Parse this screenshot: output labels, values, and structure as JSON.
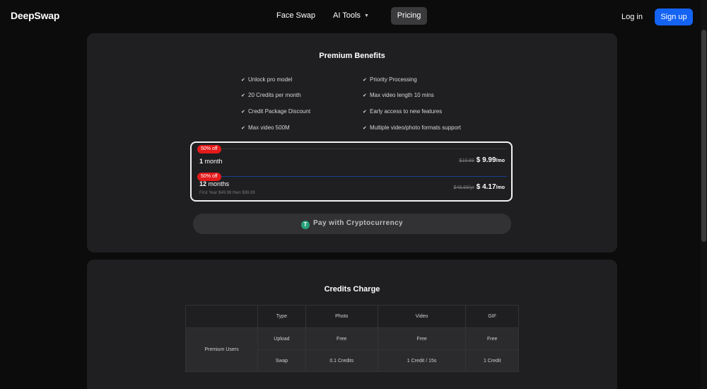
{
  "nav": {
    "logo": "DeepSwap",
    "links": [
      "Face Swap",
      "AI Tools",
      "Pricing"
    ],
    "login": "Log in",
    "signup": "Sign up"
  },
  "premium": {
    "title": "Premium Benefits",
    "benefits_left": [
      "Unlock pro model",
      "20 Credits per month",
      "Credit Package Discount",
      "Max video 500M"
    ],
    "benefits_right": [
      "Priority Processing",
      "Max video length 10 mins",
      "Early access to new features",
      "Multiple video/photo formats support"
    ],
    "plans": [
      {
        "badge": "50% off",
        "count": "1",
        "unit": " month",
        "sub": "",
        "old_price": "$19.99",
        "price": "$ 9.99",
        "per": "/mo"
      },
      {
        "badge": "50% off",
        "count": "12",
        "unit": " months",
        "sub": "First Year $49.99 then $99.99",
        "old_price": "$49.99/yr",
        "price": "$ 4.17",
        "per": "/mo"
      }
    ],
    "crypto_label": "Pay with Cryptocurrency",
    "crypto_icon_letter": "T"
  },
  "credits": {
    "title": "Credits Charge",
    "headers": [
      "Type",
      "Photo",
      "Video",
      "GIF"
    ],
    "row_label": "Premium Users",
    "rows": [
      [
        "Upload",
        "Free",
        "Free",
        "Free"
      ],
      [
        "Swap",
        "0.1 Credits",
        "1 Credit / 15s",
        "1 Credit"
      ]
    ]
  },
  "colors": {
    "accent": "#1463f3",
    "badge": "#e51a1a",
    "tether": "#26a17b"
  }
}
